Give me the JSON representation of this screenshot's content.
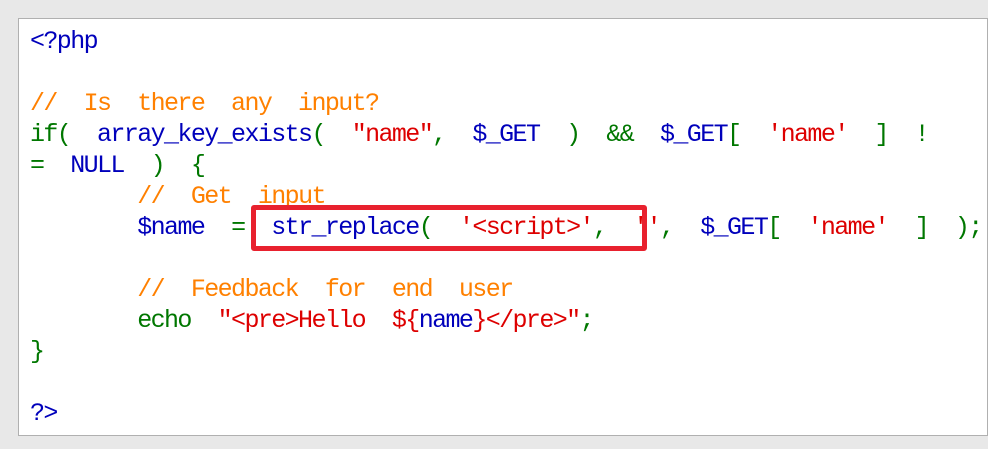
{
  "code": {
    "lines": [
      [
        {
          "t": "<?php",
          "k": "default"
        }
      ],
      [],
      [
        {
          "t": "//  Is  there  any  input?",
          "k": "comment"
        }
      ],
      [
        {
          "t": "if(  ",
          "k": "kw"
        },
        {
          "t": "array_key_exists",
          "k": "default"
        },
        {
          "t": "(  ",
          "k": "kw"
        },
        {
          "t": "\"name\"",
          "k": "string"
        },
        {
          "t": ",  ",
          "k": "kw"
        },
        {
          "t": "$_GET  ",
          "k": "default"
        },
        {
          "t": ")  &&  ",
          "k": "kw"
        },
        {
          "t": "$_GET",
          "k": "default"
        },
        {
          "t": "[  ",
          "k": "kw"
        },
        {
          "t": "'name'  ",
          "k": "string"
        },
        {
          "t": "]  !",
          "k": "kw"
        }
      ],
      [
        {
          "t": "=  ",
          "k": "kw"
        },
        {
          "t": "NULL  ",
          "k": "default"
        },
        {
          "t": ")  {",
          "k": "kw"
        }
      ],
      [
        {
          "t": "        ",
          "k": "kw"
        },
        {
          "t": "//  Get  input",
          "k": "comment"
        }
      ],
      [
        {
          "t": "        ",
          "k": "kw"
        },
        {
          "t": "$name  ",
          "k": "default"
        },
        {
          "t": "=  ",
          "k": "kw"
        },
        {
          "t": "str_replace",
          "k": "default"
        },
        {
          "t": "(  ",
          "k": "kw"
        },
        {
          "t": "'<script>'",
          "k": "string"
        },
        {
          "t": ",  ",
          "k": "kw"
        },
        {
          "t": "''",
          "k": "string"
        },
        {
          "t": ",  ",
          "k": "kw"
        },
        {
          "t": "$_GET",
          "k": "default"
        },
        {
          "t": "[  ",
          "k": "kw"
        },
        {
          "t": "'name'  ",
          "k": "string"
        },
        {
          "t": "]  );",
          "k": "kw"
        }
      ],
      [],
      [
        {
          "t": "        ",
          "k": "kw"
        },
        {
          "t": "//  Feedback  for  end  user",
          "k": "comment"
        }
      ],
      [
        {
          "t": "        echo  ",
          "k": "kw"
        },
        {
          "t": "\"<pre>Hello  ${",
          "k": "string"
        },
        {
          "t": "name",
          "k": "default"
        },
        {
          "t": "}</pre>\"",
          "k": "string"
        },
        {
          "t": ";",
          "k": "kw"
        }
      ],
      [
        {
          "t": "}",
          "k": "kw"
        }
      ],
      [],
      [
        {
          "t": "?>",
          "k": "default"
        }
      ]
    ]
  },
  "colors": {
    "comment": "#ff8000",
    "kw": "#007700",
    "default": "#0000bb",
    "string": "#dd0000",
    "highlight": "#e8212e"
  }
}
